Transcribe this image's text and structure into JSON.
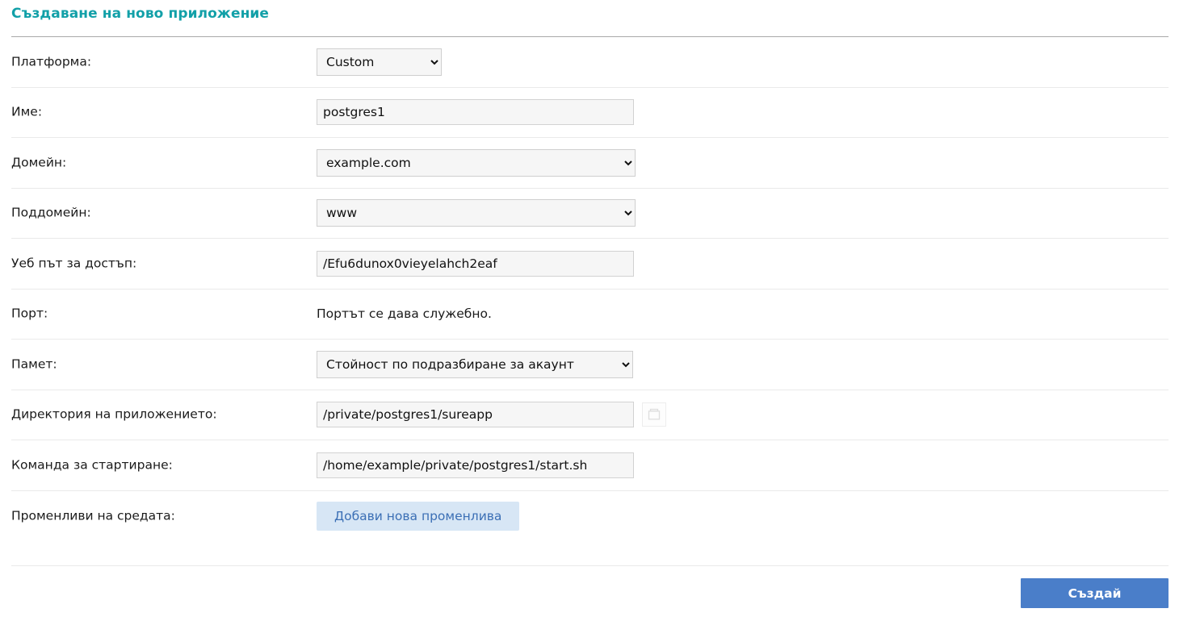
{
  "page": {
    "title": "Създаване на ново приложение"
  },
  "form": {
    "rows": [
      {
        "label": "Платформа:",
        "type": "select",
        "value": "Custom",
        "options": [
          "Custom"
        ]
      },
      {
        "label": "Име:",
        "type": "text",
        "value": "postgres1",
        "placeholder": ""
      },
      {
        "label": "Домейн:",
        "type": "select",
        "value": "example.com",
        "options": [
          "example.com"
        ]
      },
      {
        "label": "Поддомейн:",
        "type": "select",
        "value": "www",
        "options": [
          "www"
        ]
      },
      {
        "label": "Уеб път за достъп:",
        "type": "text",
        "value": "/Efu6dunox0vieyelahch2eaf",
        "placeholder": ""
      },
      {
        "label": "Порт:",
        "type": "static",
        "value": "Портът се дава служебно."
      },
      {
        "label": "Памет:",
        "type": "select",
        "value": "Стойност по подразбиране за акаунт",
        "options": [
          "Стойност по подразбиране за акаунт"
        ]
      },
      {
        "label": "Директория на приложението:",
        "type": "text-with-browse",
        "value": "/private/postgres1/sureapp",
        "placeholder": "",
        "browse_icon": "folder-icon"
      },
      {
        "label": "Команда за стартиране:",
        "type": "text",
        "value": "/home/example/private/postgres1/start.sh",
        "placeholder": ""
      },
      {
        "label": "Променливи на средата:",
        "type": "button",
        "value": "Добави нова променлива"
      }
    ]
  },
  "footer": {
    "create_label": "Създай"
  },
  "colors": {
    "title_teal": "#12a0a8",
    "create_blue": "#4a7ec9",
    "env_button_bg": "#d7e6f5",
    "env_button_text": "#3b6fb5",
    "field_bg": "#f6f6f6"
  }
}
